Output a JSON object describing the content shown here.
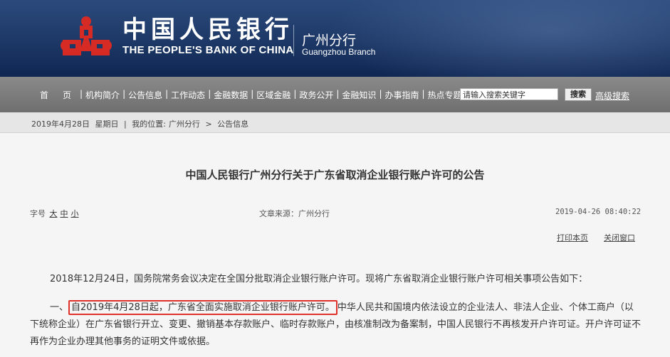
{
  "header": {
    "bank_cn": "中国人民银行",
    "bank_en": "THE PEOPLE'S BANK OF CHINA",
    "branch_cn": "广州分行",
    "branch_en": "Guangzhou  Branch",
    "logo_icon": "pboc-logo-icon",
    "brand_color": "#d62b25"
  },
  "nav": {
    "items": [
      "首页",
      "机构简介",
      "公告信息",
      "工作动态",
      "金融数据",
      "区域金融",
      "政务公开",
      "金融知识",
      "办事指南",
      "热点专题"
    ],
    "search_placeholder": "请输入搜索关键字",
    "search_button": "搜索",
    "advanced_search": "高级搜索"
  },
  "location": {
    "date": "2019年4月28日",
    "weekday": "星期日",
    "separator": "|",
    "prefix": "我的位置:",
    "crumb1": "广州分行",
    "arrow": ">",
    "crumb2": "公告信息"
  },
  "article": {
    "title": "中国人民银行广州分行关于广东省取消企业银行账户许可的公告",
    "font_label": "字号",
    "font_large": "大",
    "font_medium": "中",
    "font_small": "小",
    "source": "文章来源：广州分行",
    "datetime": "2019-04-26  08:40:22",
    "print": "打印本页",
    "close": "关闭窗口",
    "para1": "2018年12月24日，国务院常务会议决定在全国分批取消企业银行账户许可。现将广东省取消企业银行账户许可相关事项公告如下：",
    "para2_prefix": "一、",
    "para2_highlight": "自2019年4月28日起，广东省全面实施取消企业银行账户许可。",
    "para2_rest": "中华人民共和国境内依法设立的企业法人、非法人企业、个体工商户（以下统称企业）在广东省银行开立、变更、撤销基本存款账户、临时存款账户，由核准制改为备案制，中国人民银行不再核发开户许可证。开户许可证不再作为企业办理其他事务的证明文件或依据。",
    "highlight_color": "#e0302a"
  }
}
